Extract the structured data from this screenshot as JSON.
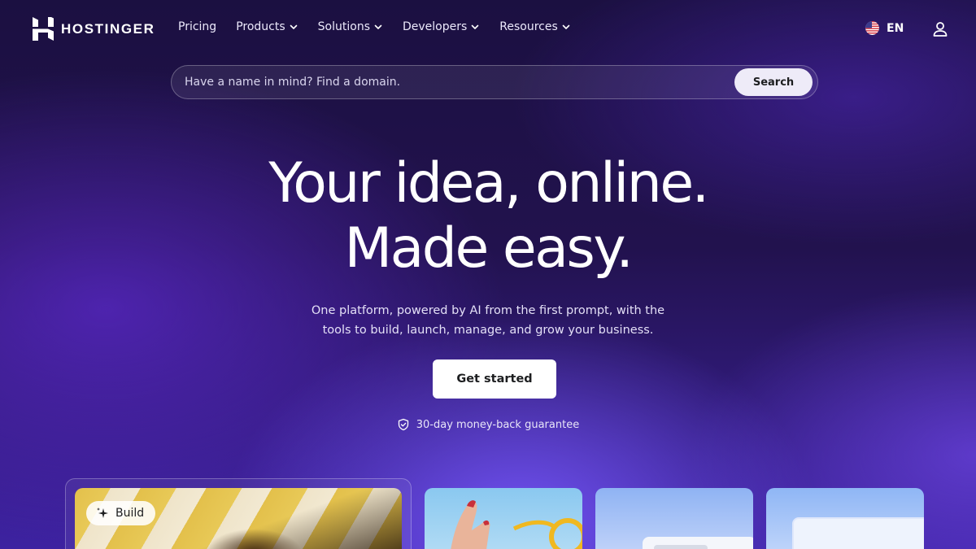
{
  "brand": {
    "name": "HOSTINGER"
  },
  "nav": {
    "items": [
      {
        "label": "Pricing",
        "has_dropdown": false
      },
      {
        "label": "Products",
        "has_dropdown": true
      },
      {
        "label": "Solutions",
        "has_dropdown": true
      },
      {
        "label": "Developers",
        "has_dropdown": true
      },
      {
        "label": "Resources",
        "has_dropdown": true
      }
    ],
    "language": "EN",
    "icons": {
      "language": "us-flag-icon",
      "account": "user-icon"
    }
  },
  "search": {
    "placeholder": "Have a name in mind? Find a domain.",
    "value": "",
    "button_label": "Search"
  },
  "hero": {
    "title_line1": "Your idea, online.",
    "title_line2": "Made easy.",
    "subtitle_line1": "One platform, powered by AI from the first prompt, with the",
    "subtitle_line2": "tools to build, launch, manage, and grow your business.",
    "cta_label": "Get started",
    "guarantee": "30-day money-back guarantee"
  },
  "cards": {
    "build_label": "Build"
  },
  "colors": {
    "background_top": "#1b1041",
    "background_bottom": "#3d22a1",
    "accent": "#673de6",
    "cta_bg": "#ffffff",
    "cta_text": "#1d1e20"
  }
}
